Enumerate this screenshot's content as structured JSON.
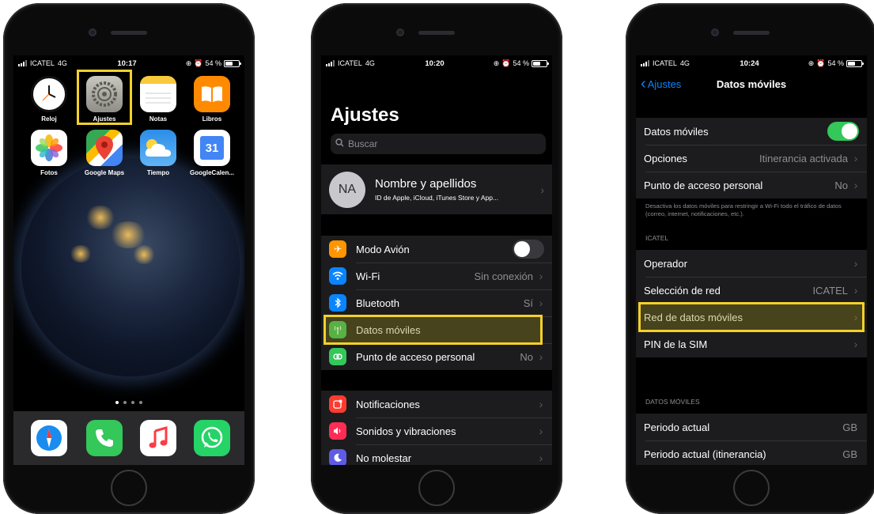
{
  "phone1": {
    "status": {
      "carrier": "ICATEL",
      "network": "4G",
      "time": "10:17",
      "battery": "54 %"
    },
    "apps": [
      {
        "label": "Reloj",
        "icon": "clock-icon"
      },
      {
        "label": "Ajustes",
        "icon": "settings-gear-icon",
        "highlighted": true
      },
      {
        "label": "Notas",
        "icon": "notes-icon"
      },
      {
        "label": "Libros",
        "icon": "books-icon"
      },
      {
        "label": "Fotos",
        "icon": "photos-icon"
      },
      {
        "label": "Google Maps",
        "icon": "maps-pin-icon"
      },
      {
        "label": "Tiempo",
        "icon": "weather-cloud-icon"
      },
      {
        "label": "GoogleCalen...",
        "icon": "calendar-icon",
        "day": "31"
      }
    ],
    "dock": [
      {
        "icon": "safari-compass-icon"
      },
      {
        "icon": "phone-icon"
      },
      {
        "icon": "music-note-icon"
      },
      {
        "icon": "whatsapp-icon"
      }
    ],
    "page_dots": 4,
    "highlight_color": "#f4d12a"
  },
  "phone2": {
    "status": {
      "carrier": "ICATEL",
      "network": "4G",
      "time": "10:20",
      "battery": "54 %"
    },
    "title": "Ajustes",
    "search_placeholder": "Buscar",
    "profile": {
      "initials": "NA",
      "name": "Nombre y apellidos",
      "subtitle": "ID de Apple, iCloud, iTunes Store y App..."
    },
    "group1": [
      {
        "label": "Modo Avión",
        "icon": "airplane-icon",
        "color": "#ff9500",
        "toggle": false
      },
      {
        "label": "Wi-Fi",
        "icon": "wifi-icon",
        "color": "#0a84ff",
        "value": "Sin conexión"
      },
      {
        "label": "Bluetooth",
        "icon": "bluetooth-icon",
        "color": "#0a84ff",
        "value": "Sí"
      },
      {
        "label": "Datos móviles",
        "icon": "antenna-icon",
        "color": "#34c759",
        "value": "",
        "highlighted": true
      },
      {
        "label": "Punto de acceso personal",
        "icon": "hotspot-icon",
        "color": "#34c759",
        "value": "No"
      }
    ],
    "group2": [
      {
        "label": "Notificaciones",
        "icon": "notifications-icon",
        "color": "#ff3b30"
      },
      {
        "label": "Sonidos y vibraciones",
        "icon": "speaker-icon",
        "color": "#ff2d55"
      },
      {
        "label": "No molestar",
        "icon": "moon-icon",
        "color": "#5e5ce6"
      }
    ]
  },
  "phone3": {
    "status": {
      "carrier": "ICATEL",
      "network": "4G",
      "time": "10:24",
      "battery": "54 %"
    },
    "back_label": "Ajustes",
    "nav_title": "Datos móviles",
    "group1": [
      {
        "label": "Datos móviles",
        "toggle": true
      },
      {
        "label": "Opciones",
        "value": "Itinerancia activada"
      },
      {
        "label": "Punto de acceso personal",
        "value": "No"
      }
    ],
    "note": "Desactiva los datos móviles para restringir a Wi-Fi todo el tráfico de datos (correo, internet, notificaciones, etc.).",
    "section_carrier": "ICATEL",
    "group2": [
      {
        "label": "Operador",
        "value": ""
      },
      {
        "label": "Selección de red",
        "value": "ICATEL"
      },
      {
        "label": "Red de datos móviles",
        "value": "",
        "highlighted": true
      },
      {
        "label": "PIN de la SIM",
        "value": ""
      }
    ],
    "section_data": "DATOS MÓVILES",
    "group3": [
      {
        "label": "Periodo actual",
        "value": "GB"
      },
      {
        "label": "Periodo actual (itinerancia)",
        "value": "GB"
      }
    ],
    "toggle_on_color": "#34c759",
    "link_color": "#0a84ff"
  }
}
